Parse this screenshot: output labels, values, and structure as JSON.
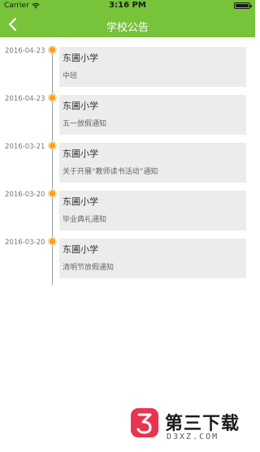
{
  "status": {
    "carrier": "Carrier",
    "time": "3:16 PM"
  },
  "header": {
    "title": "学校公告"
  },
  "notices": [
    {
      "date": "2016-04-23",
      "school": "东圃小学",
      "subject": "中班"
    },
    {
      "date": "2016-04-23",
      "school": "东圃小学",
      "subject": "五一放假通知"
    },
    {
      "date": "2016-03-21",
      "school": "东圃小学",
      "subject": "关于开展“教师读书活动”通知"
    },
    {
      "date": "2016-03-20",
      "school": "东圃小学",
      "subject": "毕业典礼通知"
    },
    {
      "date": "2016-03-20",
      "school": "东圃小学",
      "subject": "清明节放假通知"
    }
  ],
  "watermark": {
    "name": "第三下载",
    "domain": "D3XZ.COM"
  },
  "colors": {
    "header": "#77c33a",
    "dot": "#f7a11a",
    "card": "#ececec",
    "logo": "#e8344e"
  },
  "icons": {
    "back": "chevron-left-icon",
    "wifi": "wifi-icon",
    "battery": "battery-icon"
  }
}
